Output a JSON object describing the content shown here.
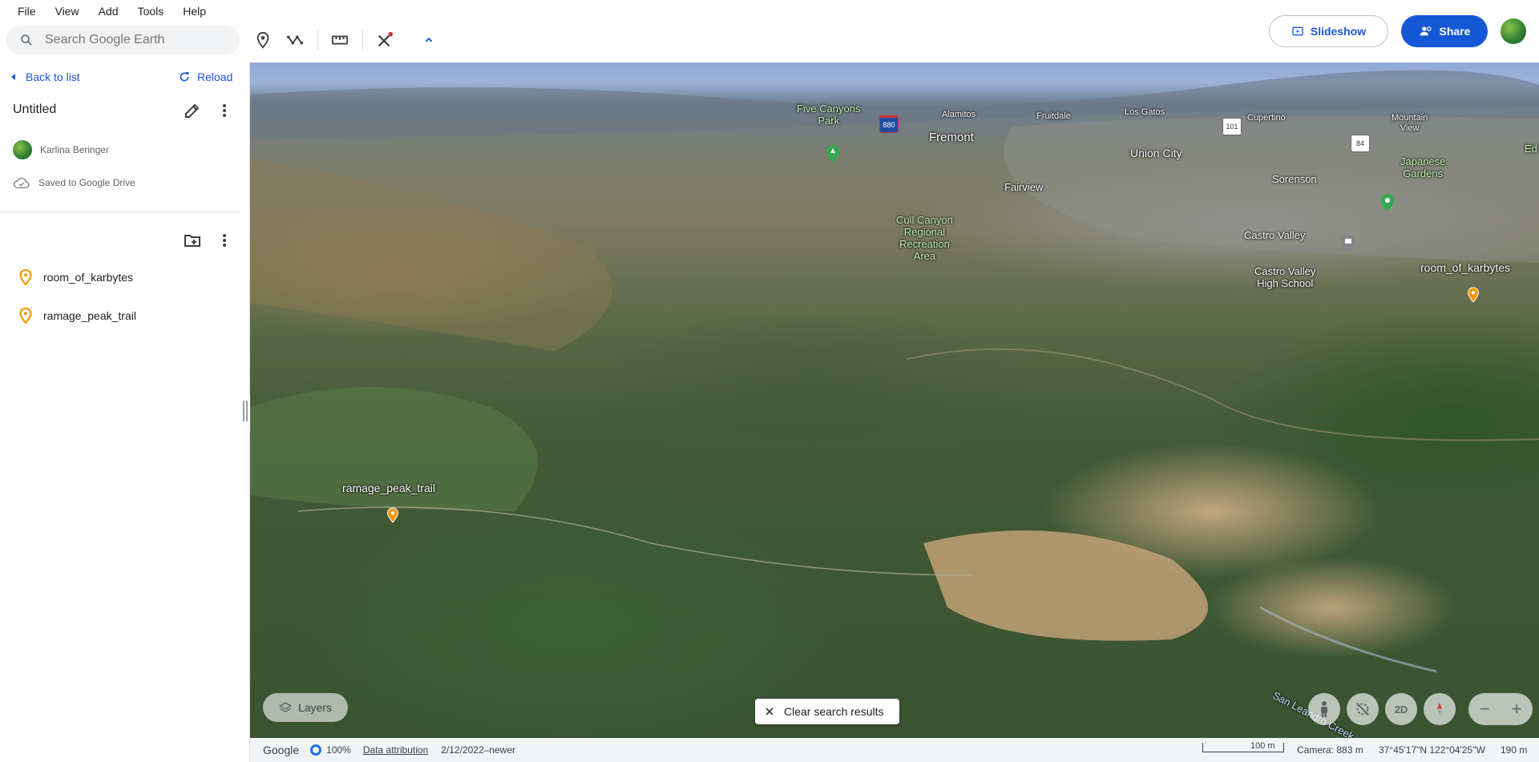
{
  "menu": [
    "File",
    "View",
    "Add",
    "Tools",
    "Help"
  ],
  "search": {
    "placeholder": "Search Google Earth"
  },
  "toolbar": {
    "slideshow_label": "Slideshow",
    "share_label": "Share"
  },
  "sidebar": {
    "back_label": "Back to list",
    "reload_label": "Reload",
    "project_title": "Untitled",
    "owner_name": "Karlina Beringer",
    "saved_text": "Saved to Google Drive",
    "items": [
      {
        "label": "room_of_karbytes",
        "icon": "placemark-icon"
      },
      {
        "label": "ramage_peak_trail",
        "icon": "placemark-icon"
      }
    ]
  },
  "map": {
    "labels": {
      "five_canyons": "Five Canyons\nPark",
      "alamitos": "Alamitos",
      "fruitdale": "Fruitdale",
      "los_gatos": "Los Gatos",
      "cupertino": "Cupertino",
      "mountain_view": "Mountain\nView",
      "fremont": "Fremont",
      "union_city": "Union City",
      "sorenson": "Sorenson",
      "japanese_gardens": "Japanese\nGardens",
      "fairview": "Fairview",
      "cull_canyon": "Cull Canyon\nRegional\nRecreation\nArea",
      "castro_valley": "Castro Valley",
      "castro_valley_hs": "Castro Valley\nHigh School",
      "room_of_karbytes": "room_of_karbytes",
      "ramage_peak_trail": "ramage_peak_trail",
      "san_leandro_creek": "San Leandro Creek",
      "edge_label": "Ed"
    },
    "shields": {
      "i880": "880",
      "us101": "101",
      "r84": "84"
    },
    "layers_label": "Layers",
    "clear_label": "Clear search results",
    "mode_2d": "2D"
  },
  "status": {
    "brand": "Google",
    "load_percent": "100%",
    "attribution": "Data attribution",
    "imagery_date": "2/12/2022–newer",
    "scale": "100 m",
    "camera": "Camera: 883 m",
    "coords": "37°45'17\"N 122°04'25\"W",
    "elevation": "190 m"
  },
  "colors": {
    "accent": "#1558d6",
    "pin": "#f29900",
    "poi_green": "#34a853"
  }
}
